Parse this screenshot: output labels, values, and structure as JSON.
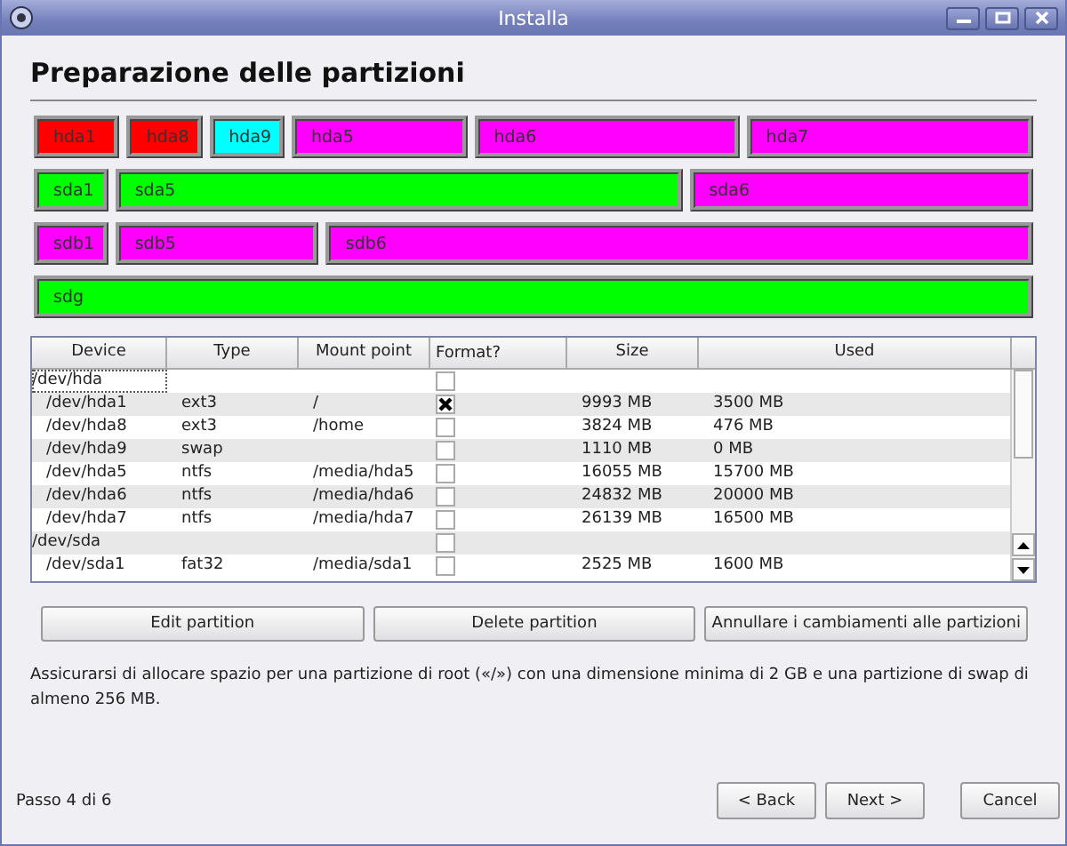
{
  "window": {
    "title": "Installa"
  },
  "heading": "Preparazione delle partizioni",
  "disks": [
    {
      "partitions": [
        {
          "label": "hda1",
          "color": "#ff0000"
        },
        {
          "label": "hda8",
          "color": "#ff0000"
        },
        {
          "label": "hda9",
          "color": "#00ffff"
        },
        {
          "label": "hda5",
          "color": "#ff00ff"
        },
        {
          "label": "hda6",
          "color": "#ff00ff"
        },
        {
          "label": "hda7",
          "color": "#ff00ff"
        }
      ]
    },
    {
      "partitions": [
        {
          "label": "sda1",
          "color": "#00ff00"
        },
        {
          "label": "sda5",
          "color": "#00ff00"
        },
        {
          "label": "sda6",
          "color": "#ff00ff"
        }
      ]
    },
    {
      "partitions": [
        {
          "label": "sdb1",
          "color": "#ff00ff"
        },
        {
          "label": "sdb5",
          "color": "#ff00ff"
        },
        {
          "label": "sdb6",
          "color": "#ff00ff"
        }
      ]
    },
    {
      "partitions": [
        {
          "label": "sdg",
          "color": "#00ff00"
        }
      ]
    }
  ],
  "table": {
    "columns": [
      "Device",
      "Type",
      "Mount point",
      "Format?",
      "Size",
      "Used"
    ],
    "rows": [
      {
        "kind": "disk",
        "selected": true,
        "device": "/dev/hda",
        "format": false
      },
      {
        "kind": "partition",
        "selected": false,
        "device": "/dev/hda1",
        "type": "ext3",
        "mount": "/",
        "format": true,
        "size": "9993 MB",
        "used": "3500 MB"
      },
      {
        "kind": "partition",
        "selected": false,
        "device": "/dev/hda8",
        "type": "ext3",
        "mount": "/home",
        "format": false,
        "size": "3824 MB",
        "used": "476 MB"
      },
      {
        "kind": "partition",
        "selected": false,
        "device": "/dev/hda9",
        "type": "swap",
        "format": false,
        "size": "1110 MB",
        "used": "0 MB"
      },
      {
        "kind": "partition",
        "selected": false,
        "device": "/dev/hda5",
        "type": "ntfs",
        "mount": "/media/hda5",
        "format": false,
        "size": "16055 MB",
        "used": "15700 MB"
      },
      {
        "kind": "partition",
        "selected": false,
        "device": "/dev/hda6",
        "type": "ntfs",
        "mount": "/media/hda6",
        "format": false,
        "size": "24832 MB",
        "used": "20000 MB"
      },
      {
        "kind": "partition",
        "selected": false,
        "device": "/dev/hda7",
        "type": "ntfs",
        "mount": "/media/hda7",
        "format": false,
        "size": "26139 MB",
        "used": "16500 MB"
      },
      {
        "kind": "disk",
        "selected": false,
        "device": "/dev/sda",
        "format": false
      },
      {
        "kind": "partition",
        "selected": false,
        "device": "/dev/sda1",
        "type": "fat32",
        "mount": "/media/sda1",
        "format": false,
        "size": "2525 MB",
        "used": "1600 MB"
      }
    ]
  },
  "actions": [
    "Edit partition",
    "Delete partition",
    "Annullare i cambiamenti alle partizioni"
  ],
  "note": "Assicurarsi di allocare spazio per una partizione di root («/») con una dimensione minima di 2 GB e una partizione di swap di almeno 256 MB.",
  "step": "Passo 4 di 6",
  "nav": [
    "< Back",
    "Next >"
  ],
  "cancel": "Cancel"
}
